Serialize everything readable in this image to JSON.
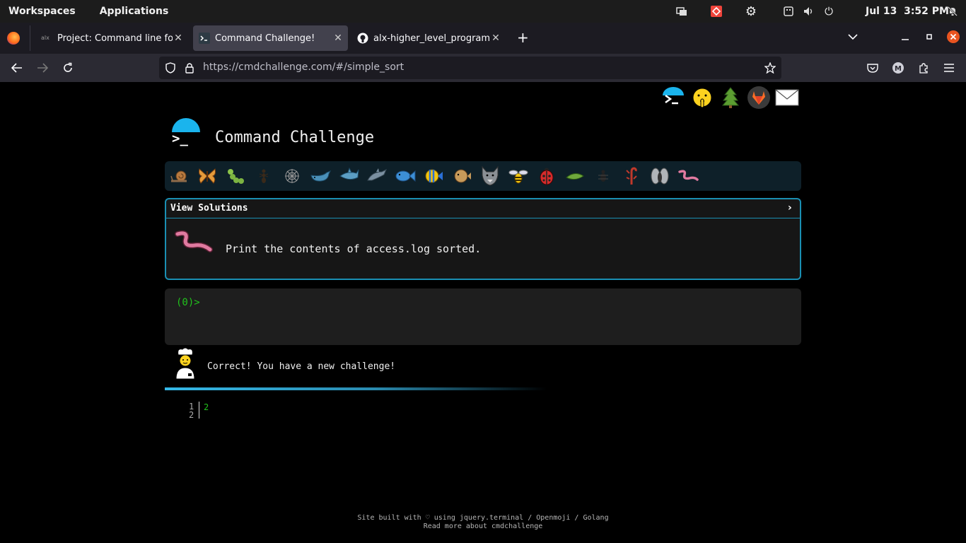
{
  "topbar": {
    "workspaces": "Workspaces",
    "applications": "Applications",
    "date": "Jul 13",
    "time": "3:52 PM",
    "tray_icons": [
      "screen-share-icon",
      "anydesk-icon",
      "settings-icon",
      "keyboard-icon",
      "volume-icon",
      "power-icon",
      "notifications-off-icon"
    ]
  },
  "browser": {
    "tabs": [
      {
        "title": "Project: Command line for the",
        "favicon": "alx-icon",
        "active": false
      },
      {
        "title": "Command Challenge!",
        "favicon": "terminal-icon",
        "active": true
      },
      {
        "title": "alx-higher_level_programming",
        "favicon": "github-icon",
        "active": false
      }
    ],
    "new_tab": "+",
    "url": "https://cmdchallenge.com/#/simple_sort"
  },
  "page": {
    "social_icons": [
      "cmdchallenge-icon",
      "shushing-face-icon",
      "tree-icon",
      "gitlab-icon",
      "envelope-icon"
    ],
    "title": "Command Challenge",
    "logo_prompt": ">_",
    "animal_icons": [
      "snail",
      "butterfly",
      "caterpillar",
      "ant",
      "spider-web",
      "whale",
      "shark",
      "dolphin",
      "fish",
      "tropical-fish",
      "blowfish",
      "wolf",
      "bee",
      "lady-beetle",
      "bean-pod",
      "bug",
      "scorpion",
      "fly",
      "worm"
    ],
    "view_solutions": "View Solutions",
    "chevron": "›",
    "task": "Print the contents of access.log sorted.",
    "prompt": "(0)>",
    "result": "Correct! You have a new challenge!",
    "output": {
      "line_numbers": [
        "1",
        "2"
      ],
      "text": "2"
    },
    "footer_line1": "Site built with ♡ using jquery.terminal / Openmoji / Golang",
    "footer_line2": "Read more about cmdchallenge"
  },
  "colors": {
    "accent": "#1ab4ed",
    "prompt_green": "#21c21c",
    "box_border": "#1a8fb3"
  }
}
